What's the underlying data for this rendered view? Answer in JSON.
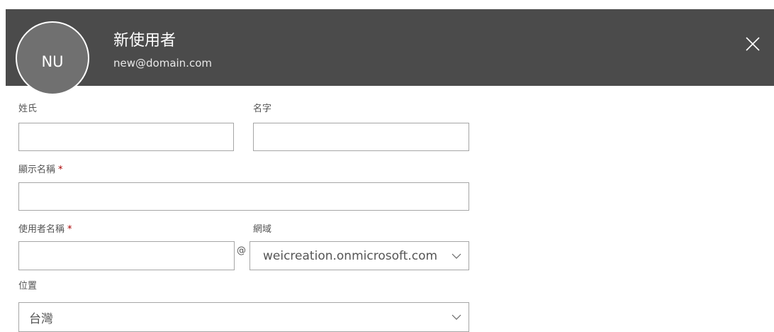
{
  "header": {
    "avatar_initials": "NU",
    "display_name": "新使用者",
    "email": "new@domain.com",
    "background": "#4b4b4b"
  },
  "form": {
    "last_name": {
      "label": "姓氏",
      "value": ""
    },
    "first_name": {
      "label": "名字",
      "value": ""
    },
    "display_name": {
      "label": "顯示名稱",
      "required_mark": "*",
      "value": ""
    },
    "username": {
      "label": "使用者名稱",
      "required_mark": "*",
      "value": ""
    },
    "at_symbol": "@",
    "domain": {
      "label": "網域",
      "selected": "weicreation.onmicrosoft.com"
    },
    "location": {
      "label": "位置",
      "selected": "台灣"
    }
  },
  "icons": {
    "close": "close-icon",
    "dropdown": "chevron-down-icon"
  },
  "colors": {
    "required": "#a80000",
    "border": "#a6a6a6"
  }
}
